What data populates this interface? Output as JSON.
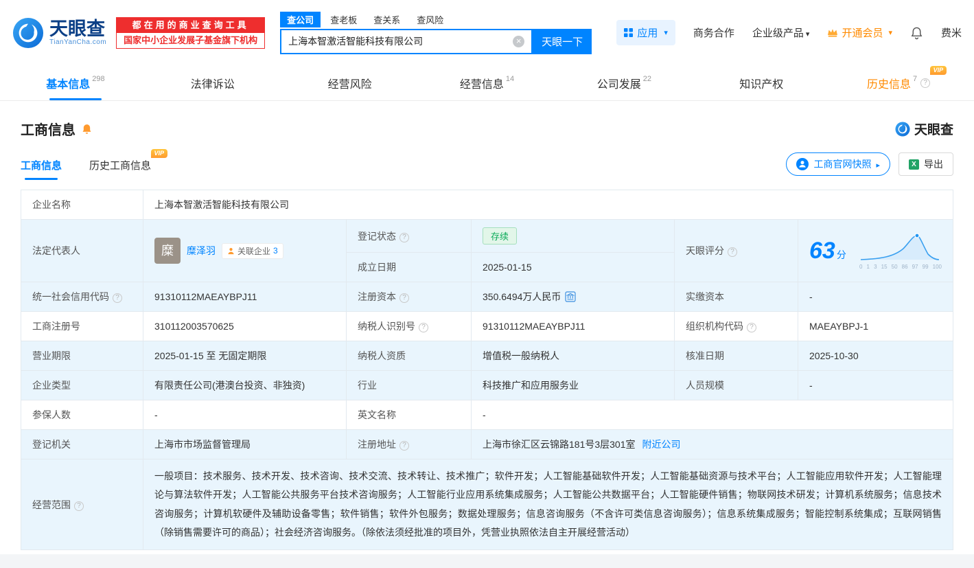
{
  "colors": {
    "primary_blue": "#0084ff",
    "vip_orange": "#ff8a00",
    "brand_red": "#ee2e2e",
    "status_green": "#0cab59",
    "row_highlight_blue": "#e9f5fd"
  },
  "header": {
    "logo": {
      "title": "天眼查",
      "subtitle": "TianYanCha.com"
    },
    "slogan": {
      "line1": "都在用的商业查询工具",
      "line2": "国家中小企业发展子基金旗下机构"
    },
    "search": {
      "tabs": [
        {
          "label": "查公司"
        },
        {
          "label": "查老板"
        },
        {
          "label": "查关系"
        },
        {
          "label": "查风险"
        }
      ],
      "value": "上海本智激活智能科技有限公司",
      "button": "天眼一下"
    },
    "nav": {
      "apps": "应用",
      "cooperation": "商务合作",
      "enterprise": "企业级产品",
      "vip": "开通会员",
      "user": "费米"
    }
  },
  "tabs": [
    {
      "label": "基本信息",
      "count": "298"
    },
    {
      "label": "法律诉讼"
    },
    {
      "label": "经营风险"
    },
    {
      "label": "经营信息",
      "count": "14"
    },
    {
      "label": "公司发展",
      "count": "22"
    },
    {
      "label": "知识产权"
    },
    {
      "label": "历史信息",
      "count": "7",
      "vip": "VIP"
    }
  ],
  "section": {
    "title": "工商信息",
    "brand": "天眼查",
    "subtabs": [
      {
        "label": "工商信息"
      },
      {
        "label": "历史工商信息",
        "vip": "VIP"
      }
    ],
    "snapshot_button": "工商官网快照",
    "export_button": "导出"
  },
  "info": {
    "company_name": {
      "label": "企业名称",
      "value": "上海本智激活智能科技有限公司"
    },
    "legal_rep": {
      "label": "法定代表人",
      "avatar": "糜",
      "name": "糜泽羽",
      "related_label": "关联企业",
      "related_count": "3"
    },
    "reg_status": {
      "label": "登记状态",
      "value": "存续"
    },
    "est_date": {
      "label": "成立日期",
      "value": "2025-01-15"
    },
    "score": {
      "label": "天眼评分",
      "value": "63",
      "unit": "分",
      "axis": [
        "0",
        "1",
        "3",
        "15",
        "50",
        "86",
        "97",
        "99",
        "100"
      ]
    },
    "credit_code": {
      "label": "统一社会信用代码",
      "value": "91310112MAEAYBPJ11"
    },
    "reg_capital": {
      "label": "注册资本",
      "value": "350.6494万人民币"
    },
    "paid_capital": {
      "label": "实缴资本",
      "value": "-"
    },
    "reg_number": {
      "label": "工商注册号",
      "value": "310112003570625"
    },
    "taxpayer_id": {
      "label": "纳税人识别号",
      "value": "91310112MAEAYBPJ11"
    },
    "org_code": {
      "label": "组织机构代码",
      "value": "MAEAYBPJ-1"
    },
    "business_term": {
      "label": "营业期限",
      "value": "2025-01-15 至 无固定期限"
    },
    "taxpayer_quality": {
      "label": "纳税人资质",
      "value": "增值税一般纳税人"
    },
    "approval_date": {
      "label": "核准日期",
      "value": "2025-10-30"
    },
    "company_type": {
      "label": "企业类型",
      "value": "有限责任公司(港澳台投资、非独资)"
    },
    "industry": {
      "label": "行业",
      "value": "科技推广和应用服务业"
    },
    "staff_size": {
      "label": "人员规模",
      "value": "-"
    },
    "insured_count": {
      "label": "参保人数",
      "value": "-"
    },
    "english_name": {
      "label": "英文名称",
      "value": "-"
    },
    "reg_authority": {
      "label": "登记机关",
      "value": "上海市市场监督管理局"
    },
    "reg_address": {
      "label": "注册地址",
      "value": "上海市徐汇区云锦路181号3层301室",
      "link": "附近公司"
    },
    "business_scope": {
      "label": "经营范围",
      "value": "一般项目：技术服务、技术开发、技术咨询、技术交流、技术转让、技术推广；软件开发；人工智能基础软件开发；人工智能基础资源与技术平台；人工智能应用软件开发；人工智能理论与算法软件开发；人工智能公共服务平台技术咨询服务；人工智能行业应用系统集成服务；人工智能公共数据平台；人工智能硬件销售；物联网技术研发；计算机系统服务；信息技术咨询服务；计算机软硬件及辅助设备零售；软件销售；软件外包服务；数据处理服务；信息咨询服务（不含许可类信息咨询服务）；信息系统集成服务；智能控制系统集成；互联网销售（除销售需要许可的商品）；社会经济咨询服务。（除依法须经批准的项目外，凭营业执照依法自主开展经营活动）"
    }
  }
}
